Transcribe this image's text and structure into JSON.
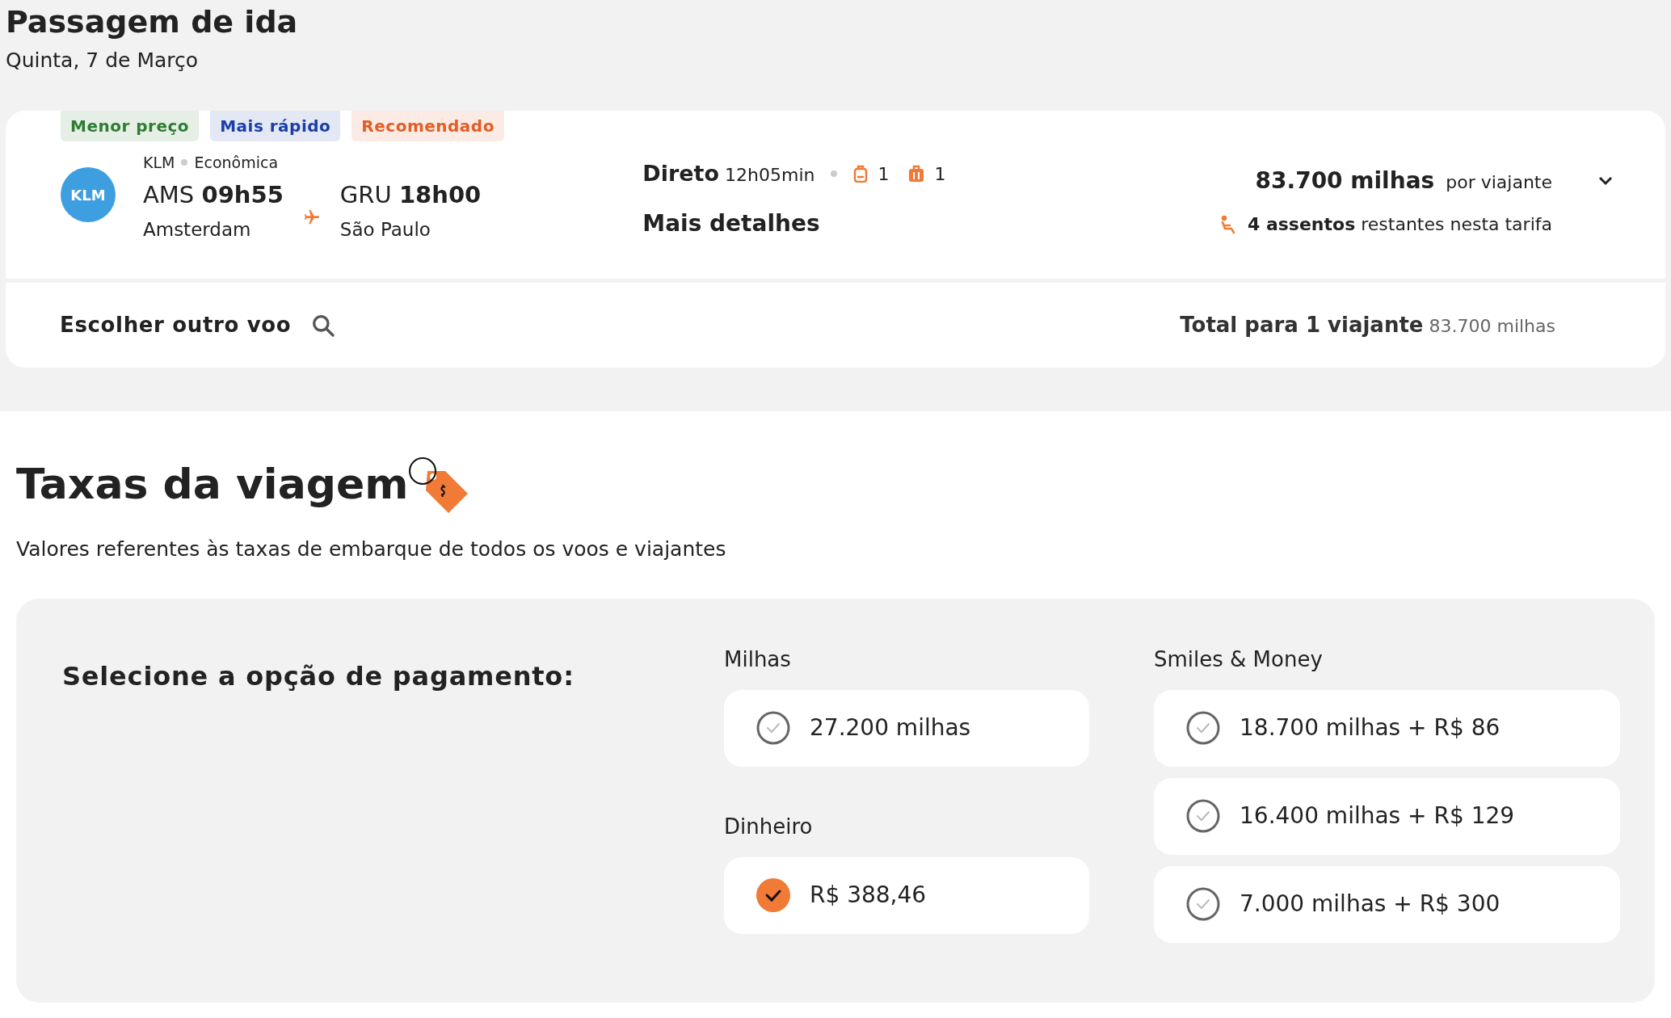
{
  "header": {
    "title": "Passagem de ida",
    "date": "Quinta, 7 de Março"
  },
  "flight": {
    "tags": [
      {
        "label": "Menor preço",
        "color": "#2e7d32"
      },
      {
        "label": "Mais rápido",
        "color": "#1a3fa8"
      },
      {
        "label": "Recomendado",
        "color": "#e35d24"
      }
    ],
    "airline": "KLM",
    "airline_logo": "KLM",
    "cabin": "Econômica",
    "origin": {
      "code": "AMS",
      "time": "09h55",
      "city": "Amsterdam"
    },
    "destination": {
      "code": "GRU",
      "time": "18h00",
      "city": "São Paulo"
    },
    "stops": "Direto",
    "duration": "12h05min",
    "carry_on": "1",
    "checked_bag": "1",
    "details_link": "Mais detalhes",
    "price": "83.700 milhas",
    "price_suffix": "por viajante",
    "seats": "**4 assentos** restantes nesta tarifa",
    "expanded": false,
    "choose_other": "Escolher outro voo",
    "total_label": "Total para 1 viajante",
    "total_value": "83.700 milhas"
  },
  "fees": {
    "title": "Taxas da viagem",
    "subtitle": "Valores referentes às taxas de embarque de todos os voos e viajantes",
    "prompt": "Selecione a opção de pagamento:",
    "groups": [
      {
        "label": "Milhas",
        "options": [
          {
            "label": "27.200 milhas",
            "selected": false
          }
        ]
      },
      {
        "label": "Dinheiro",
        "options": [
          {
            "label": "R$ 388,46",
            "selected": true
          }
        ]
      },
      {
        "label": "Smiles & Money",
        "options": [
          {
            "label": "18.700 milhas + R$ 86",
            "selected": false
          },
          {
            "label": "16.400 milhas + R$ 129",
            "selected": false
          },
          {
            "label": "7.000 milhas + R$ 300",
            "selected": false
          }
        ]
      }
    ]
  }
}
